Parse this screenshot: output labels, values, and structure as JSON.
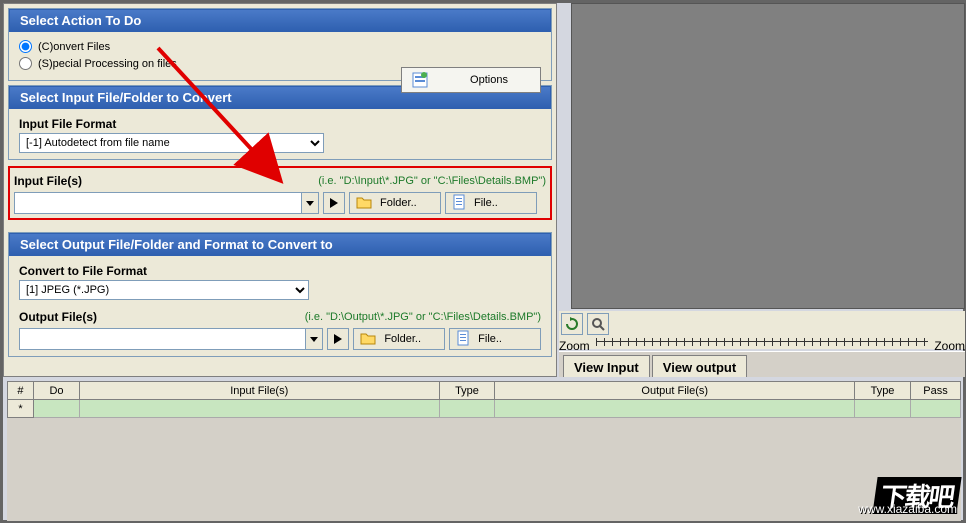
{
  "section1": {
    "header": "Select Action To Do",
    "radio_convert": "(C)onvert Files",
    "radio_special": "(S)pecial Processing on files",
    "options_btn": "Options"
  },
  "section2": {
    "header": "Select Input File/Folder to Convert",
    "format_label": "Input File Format",
    "format_value": "[-1] Autodetect from file name",
    "files_label": "Input File(s)",
    "hint": "(i.e. \"D:\\Input\\*.JPG\" or \"C:\\Files\\Details.BMP\")",
    "input_value": "",
    "folder_btn": "Folder..",
    "file_btn": "File.."
  },
  "section3": {
    "header": "Select Output File/Folder and Format to Convert to",
    "convert_label": "Convert to File Format",
    "convert_value": "[1] JPEG (*.JPG)",
    "output_label": "Output File(s)",
    "hint": "(i.e. \"D:\\Output\\*.JPG\" or \"C:\\Files\\Details.BMP\")",
    "output_value": "",
    "folder_btn": "Folder..",
    "file_btn": "File.."
  },
  "zoom": {
    "label": "Zoom",
    "label2": "Zoom"
  },
  "tabs": {
    "view_input": "View Input",
    "view_output": "View output"
  },
  "table": {
    "cols": {
      "num": "#",
      "do": "Do",
      "input": "Input File(s)",
      "type1": "Type",
      "output": "Output File(s)",
      "type2": "Type",
      "pass": "Pass"
    },
    "row_marker": "*"
  },
  "watermark": {
    "text": "下载吧",
    "url": "www.xiazaiba.com"
  }
}
